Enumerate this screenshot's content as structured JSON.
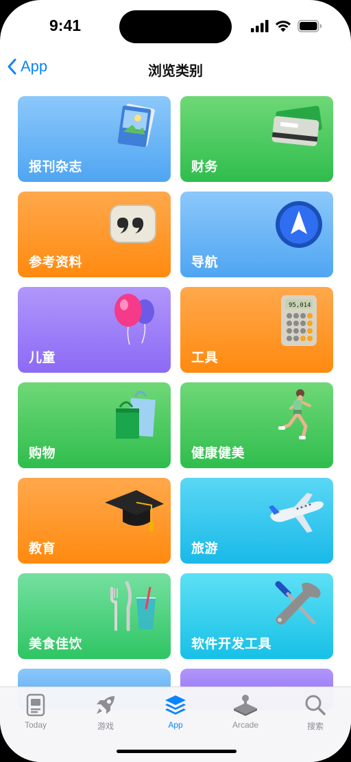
{
  "status": {
    "time": "9:41"
  },
  "nav": {
    "back_label": "App",
    "title": "浏览类别"
  },
  "categories": [
    {
      "label": "报刊杂志",
      "icon": "magazine-icon",
      "color": "#4fa5f2"
    },
    {
      "label": "财务",
      "icon": "wallet-icon",
      "color": "#2fbd4d"
    },
    {
      "label": "参考资料",
      "icon": "quote-icon",
      "color": "#ff8a0f"
    },
    {
      "label": "导航",
      "icon": "navigation-arrow-icon",
      "color": "#4fa5f2"
    },
    {
      "label": "儿童",
      "icon": "balloons-icon",
      "color": "#8c6af5"
    },
    {
      "label": "工具",
      "icon": "calculator-icon",
      "color": "#ff8a0f"
    },
    {
      "label": "购物",
      "icon": "shopping-bags-icon",
      "color": "#2fbd4d"
    },
    {
      "label": "健康健美",
      "icon": "runner-icon",
      "color": "#2fbd4d"
    },
    {
      "label": "教育",
      "icon": "graduation-cap-icon",
      "color": "#ff8a0f"
    },
    {
      "label": "旅游",
      "icon": "airplane-icon",
      "color": "#19b9e8"
    },
    {
      "label": "美食佳饮",
      "icon": "fork-knife-glass-icon",
      "color": "#2ec563"
    },
    {
      "label": "软件开发工具",
      "icon": "wrench-screwdriver-icon",
      "color": "#17c0e6"
    }
  ],
  "calculator_display": "95,014",
  "tabbar": {
    "items": [
      {
        "label": "Today",
        "icon": "today-icon"
      },
      {
        "label": "游戏",
        "icon": "rocket-icon"
      },
      {
        "label": "App",
        "icon": "app-stack-icon",
        "active": true
      },
      {
        "label": "Arcade",
        "icon": "joystick-icon"
      },
      {
        "label": "搜索",
        "icon": "search-icon"
      }
    ]
  },
  "accent_color": "#0a84ff"
}
